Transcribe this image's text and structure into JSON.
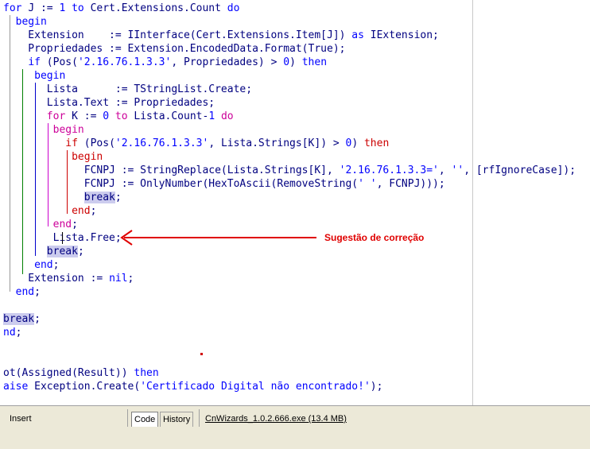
{
  "code_lines": [
    {
      "seg": [
        {
          "t": "for ",
          "c": "kw"
        },
        {
          "t": "J := "
        },
        {
          "t": "1",
          "c": "num"
        },
        {
          "t": " "
        },
        {
          "t": "to",
          "c": "kw"
        },
        {
          "t": " Cert.Extensions.Count "
        },
        {
          "t": "do",
          "c": "kw"
        }
      ]
    },
    {
      "seg": [
        {
          "t": "  "
        },
        {
          "t": "begin",
          "c": "kw"
        }
      ]
    },
    {
      "seg": [
        {
          "t": "    Extension    := IInterface(Cert.Extensions.Item[J]) "
        },
        {
          "t": "as",
          "c": "kw"
        },
        {
          "t": " IExtension;"
        }
      ]
    },
    {
      "seg": [
        {
          "t": "    Propriedades := Extension.EncodedData.Format(True);"
        }
      ]
    },
    {
      "seg": [
        {
          "t": "    "
        },
        {
          "t": "if",
          "c": "kw"
        },
        {
          "t": " (Pos("
        },
        {
          "t": "'2.16.76.1.3.3'",
          "c": "str"
        },
        {
          "t": ", Propriedades) > "
        },
        {
          "t": "0",
          "c": "num"
        },
        {
          "t": ") "
        },
        {
          "t": "then",
          "c": "kw"
        }
      ]
    },
    {
      "seg": [
        {
          "t": "     "
        },
        {
          "t": "begin",
          "c": "kw"
        }
      ]
    },
    {
      "seg": [
        {
          "t": "       Lista      := TStringList.Create;"
        }
      ]
    },
    {
      "seg": [
        {
          "t": "       Lista.Text := Propriedades;"
        }
      ]
    },
    {
      "seg": [
        {
          "t": "       "
        },
        {
          "t": "for",
          "c": "kw"
        },
        {
          "t": " K := "
        },
        {
          "t": "0",
          "c": "num"
        },
        {
          "t": " "
        },
        {
          "t": "to",
          "c": "kw"
        },
        {
          "t": " Lista.Count-"
        },
        {
          "t": "1",
          "c": "num"
        },
        {
          "t": " "
        },
        {
          "t": "do",
          "c": "kw"
        }
      ]
    },
    {
      "seg": [
        {
          "t": "        "
        },
        {
          "t": "begin",
          "c": "kw"
        }
      ]
    },
    {
      "seg": [
        {
          "t": "          "
        },
        {
          "t": "if",
          "c": "kw"
        },
        {
          "t": " (Pos("
        },
        {
          "t": "'2.16.76.1.3.3'",
          "c": "str"
        },
        {
          "t": ", Lista.Strings[K]) > "
        },
        {
          "t": "0",
          "c": "num"
        },
        {
          "t": ") "
        },
        {
          "t": "then",
          "c": "kw"
        }
      ]
    },
    {
      "seg": [
        {
          "t": "           "
        },
        {
          "t": "begin",
          "c": "kw"
        }
      ]
    },
    {
      "seg": [
        {
          "t": "             FCNPJ := StringReplace(Lista.Strings[K], "
        },
        {
          "t": "'2.16.76.1.3.3='",
          "c": "str"
        },
        {
          "t": ", "
        },
        {
          "t": "''",
          "c": "str"
        },
        {
          "t": ", [rfIgnoreCase]);"
        }
      ]
    },
    {
      "seg": [
        {
          "t": "             FCNPJ := OnlyNumber(HexToAscii(RemoveString("
        },
        {
          "t": "' '",
          "c": "str"
        },
        {
          "t": ", FCNPJ)));"
        }
      ]
    },
    {
      "seg": [
        {
          "t": "             "
        },
        {
          "t": "break",
          "c": "brk"
        },
        {
          "t": ";"
        }
      ]
    },
    {
      "seg": [
        {
          "t": "           "
        },
        {
          "t": "end",
          "c": "kw"
        },
        {
          "t": ";"
        }
      ]
    },
    {
      "seg": [
        {
          "t": "        "
        },
        {
          "t": "end",
          "c": "kw"
        },
        {
          "t": ";"
        }
      ]
    },
    {
      "seg": [
        {
          "t": "        Lista.Free;"
        }
      ]
    },
    {
      "seg": [
        {
          "t": "       "
        },
        {
          "t": "break",
          "c": "brk"
        },
        {
          "t": ";"
        }
      ]
    },
    {
      "seg": [
        {
          "t": "     "
        },
        {
          "t": "end",
          "c": "kw"
        },
        {
          "t": ";"
        }
      ]
    },
    {
      "seg": [
        {
          "t": "    Extension := "
        },
        {
          "t": "nil",
          "c": "kw"
        },
        {
          "t": ";"
        }
      ]
    },
    {
      "seg": [
        {
          "t": "  "
        },
        {
          "t": "end",
          "c": "kw"
        },
        {
          "t": ";"
        }
      ]
    },
    {
      "seg": [
        {
          "t": ""
        }
      ]
    },
    {
      "seg": [
        {
          "t": "break",
          "c": "brk"
        },
        {
          "t": ";"
        }
      ]
    },
    {
      "seg": [
        {
          "t": "nd",
          "c": "kw"
        },
        {
          "t": ";"
        }
      ]
    },
    {
      "seg": [
        {
          "t": ""
        }
      ]
    },
    {
      "seg": [
        {
          "t": ""
        }
      ]
    },
    {
      "seg": [
        {
          "t": "ot(Assigned(Result)) "
        },
        {
          "t": "then",
          "c": "kw"
        }
      ]
    },
    {
      "seg": [
        {
          "t": "aise",
          "c": "kw"
        },
        {
          "t": " Exception.Create("
        },
        {
          "t": "'Certificado Digital não encontrado!'",
          "c": "str"
        },
        {
          "t": ");"
        }
      ]
    }
  ],
  "colors": {
    "keyword": "#0000ff",
    "keyword_block": "#cc0099",
    "text": "#000080",
    "string": "#0000ff",
    "break_bg": "#ccccee",
    "annotation": "#e00000"
  },
  "annotation": {
    "label": "Sugestão de correção"
  },
  "statusbar": {
    "mode": "Insert",
    "tab_code": "Code",
    "tab_history": "History",
    "file_info": "CnWizards_1.0.2.666.exe (13.4 MB)"
  }
}
